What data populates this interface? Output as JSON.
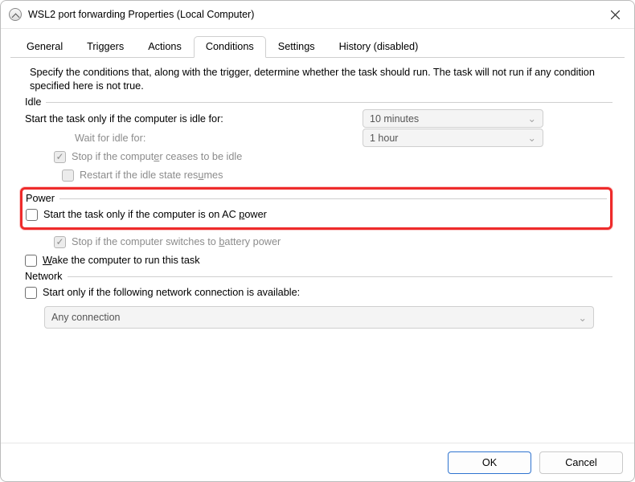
{
  "window": {
    "title": "WSL2 port forwarding Properties (Local Computer)"
  },
  "tabs": {
    "general": "General",
    "triggers": "Triggers",
    "actions": "Actions",
    "conditions": "Conditions",
    "settings": "Settings",
    "history": "History (disabled)"
  },
  "active_tab": "conditions",
  "desc": "Specify the conditions that, along with the trigger, determine whether the task should run.  The task will not run  if any condition specified here is not true.",
  "groups": {
    "idle": {
      "label": "Idle",
      "start_if_idle_pre": "Start the task only if the ",
      "start_if_idle_ukey": "c",
      "start_if_idle_post": "omputer is idle for:",
      "idle_duration": "10 minutes",
      "wait_label": "Wait for idle for:",
      "wait_duration": "1 hour",
      "stop_cease_pre": "Stop if the comput",
      "stop_cease_ukey": "e",
      "stop_cease_post": "r ceases to be idle",
      "restart_pre": "Restart if the idle state res",
      "restart_ukey": "u",
      "restart_post": "mes"
    },
    "power": {
      "label": "Power",
      "ac_pre": "Start the task only if the computer is on AC ",
      "ac_ukey": "p",
      "ac_post": "ower",
      "battery_pre": "Stop if the computer switches to ",
      "battery_ukey": "b",
      "battery_post": "attery power",
      "wake_pre": "",
      "wake_ukey": "W",
      "wake_post": "ake the computer to run this task"
    },
    "network": {
      "label": "Network",
      "avail": "Start only if the following network connection is available:",
      "connection": "Any connection"
    }
  },
  "buttons": {
    "ok": "OK",
    "cancel": "Cancel"
  }
}
